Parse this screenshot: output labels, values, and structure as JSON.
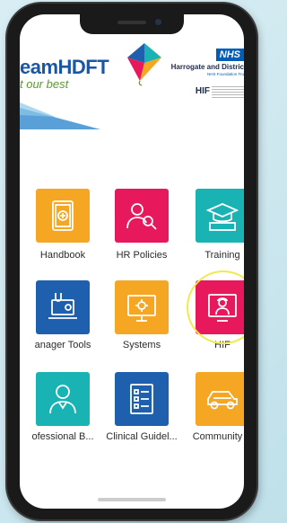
{
  "header": {
    "brand_title": "eamHDFT",
    "brand_tagline": "t our best",
    "nhs_badge": "NHS",
    "trust_name": "Harrogate and Distric",
    "trust_subtitle": "NHS Foundation Tru",
    "hif_label": "HIF"
  },
  "tiles": [
    {
      "label": "Handbook",
      "icon": "handbook-icon",
      "color": "#f5a623"
    },
    {
      "label": "HR Policies",
      "icon": "hr-policies-icon",
      "color": "#e8185c"
    },
    {
      "label": "Training",
      "icon": "graduation-cap-icon",
      "color": "#1ab3b3"
    },
    {
      "label": "anager Tools",
      "icon": "stethoscope-laptop-icon",
      "color": "#1e5fae"
    },
    {
      "label": "Systems",
      "icon": "gear-monitor-icon",
      "color": "#f5a623"
    },
    {
      "label": "HIF",
      "icon": "headset-person-icon",
      "color": "#e8185c"
    },
    {
      "label": "ofessional B...",
      "icon": "doctor-icon",
      "color": "#1ab3b3"
    },
    {
      "label": "Clinical Guidel...",
      "icon": "checklist-icon",
      "color": "#1e5fae"
    },
    {
      "label": "Community C",
      "icon": "car-icon",
      "color": "#f5a623"
    }
  ]
}
